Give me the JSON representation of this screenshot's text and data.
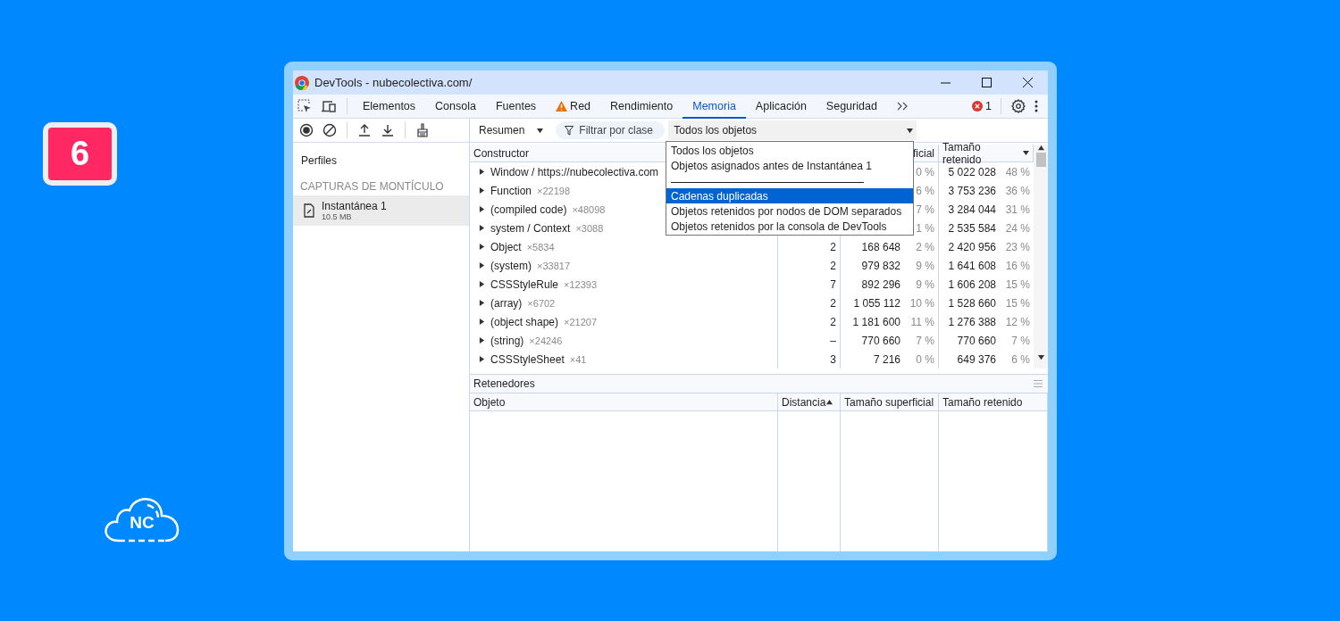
{
  "badge": "6",
  "logo": {
    "text": "NC"
  },
  "window": {
    "title": "DevTools - nubecolectiva.com/"
  },
  "tabs": [
    {
      "label": "Elementos",
      "selected": false,
      "warning": false
    },
    {
      "label": "Consola",
      "selected": false,
      "warning": false
    },
    {
      "label": "Fuentes",
      "selected": false,
      "warning": false
    },
    {
      "label": "Red",
      "selected": false,
      "warning": true
    },
    {
      "label": "Rendimiento",
      "selected": false,
      "warning": false
    },
    {
      "label": "Memoria",
      "selected": true,
      "warning": false
    },
    {
      "label": "Aplicación",
      "selected": false,
      "warning": false
    },
    {
      "label": "Seguridad",
      "selected": false,
      "warning": false
    }
  ],
  "error_count": "1",
  "sidebar": {
    "title": "Perfiles",
    "section": "CAPTURAS DE MONTÍCULO",
    "items": [
      {
        "name": "Instantánea 1",
        "size": "10.5 MB",
        "selected": true
      }
    ]
  },
  "toolbar": {
    "view": "Resumen",
    "filter": {
      "placeholder": "Filtrar por clase"
    },
    "scope": "Todos los objetos"
  },
  "dropdown": {
    "options": [
      {
        "kind": "option",
        "label": "Todos los objetos",
        "selected": false
      },
      {
        "kind": "option",
        "label": "Objetos asignados antes de Instantánea 1",
        "selected": false
      },
      {
        "kind": "separator"
      },
      {
        "kind": "option",
        "label": "Cadenas duplicadas",
        "selected": true
      },
      {
        "kind": "option",
        "label": "Objetos retenidos por nodos de DOM separados",
        "selected": false
      },
      {
        "kind": "option",
        "label": "Objetos retenidos por la consola de DevTools",
        "selected": false
      }
    ]
  },
  "table": {
    "header": {
      "column_1": "Constructor",
      "column_3": "ficial",
      "column_4": "Tamaño retenido"
    },
    "rows": [
      {
        "name": "Window / https://nubecolectiva.com",
        "shallow_pct": "0 %",
        "retained": "5 022 028",
        "retained_pct": "48 %"
      },
      {
        "name": "Function",
        "count": "×22198",
        "shallow_pct": "6 %",
        "retained": "3 753 236",
        "retained_pct": "36 %"
      },
      {
        "name": "(compiled code)",
        "count": "×48098",
        "shallow_pct": "7 %",
        "retained": "3 284 044",
        "retained_pct": "31 %"
      },
      {
        "name": "system / Context",
        "count": "×3088",
        "shallow_pct": "1 %",
        "retained": "2 535 584",
        "retained_pct": "24 %"
      },
      {
        "name": "Object",
        "count": "×5834",
        "distance": "2",
        "shallow": "168 648",
        "shallow_pct": "2 %",
        "retained": "2 420 956",
        "retained_pct": "23 %"
      },
      {
        "name": "(system)",
        "count": "×33817",
        "distance": "2",
        "shallow": "979 832",
        "shallow_pct": "9 %",
        "retained": "1 641 608",
        "retained_pct": "16 %"
      },
      {
        "name": "CSSStyleRule",
        "count": "×12393",
        "distance": "7",
        "shallow": "892 296",
        "shallow_pct": "9 %",
        "retained": "1 606 208",
        "retained_pct": "15 %"
      },
      {
        "name": "(array)",
        "count": "×6702",
        "distance": "2",
        "shallow": "1 055 112",
        "shallow_pct": "10 %",
        "retained": "1 528 660",
        "retained_pct": "15 %"
      },
      {
        "name": "(object shape)",
        "count": "×21207",
        "distance": "2",
        "shallow": "1 181 600",
        "shallow_pct": "11 %",
        "retained": "1 276 388",
        "retained_pct": "12 %"
      },
      {
        "name": "(string)",
        "count": "×24246",
        "distance": "–",
        "shallow": "770 660",
        "shallow_pct": "7 %",
        "retained": "770 660",
        "retained_pct": "7 %"
      },
      {
        "name": "CSSStyleSheet",
        "count": "×41",
        "distance": "3",
        "shallow": "7 216",
        "shallow_pct": "0 %",
        "retained": "649 376",
        "retained_pct": "6 %"
      }
    ]
  },
  "retainers": {
    "title": "Retenedores",
    "columns": [
      "Objeto",
      "Distancia",
      "Tamaño superficial",
      "Tamaño retenido"
    ]
  }
}
